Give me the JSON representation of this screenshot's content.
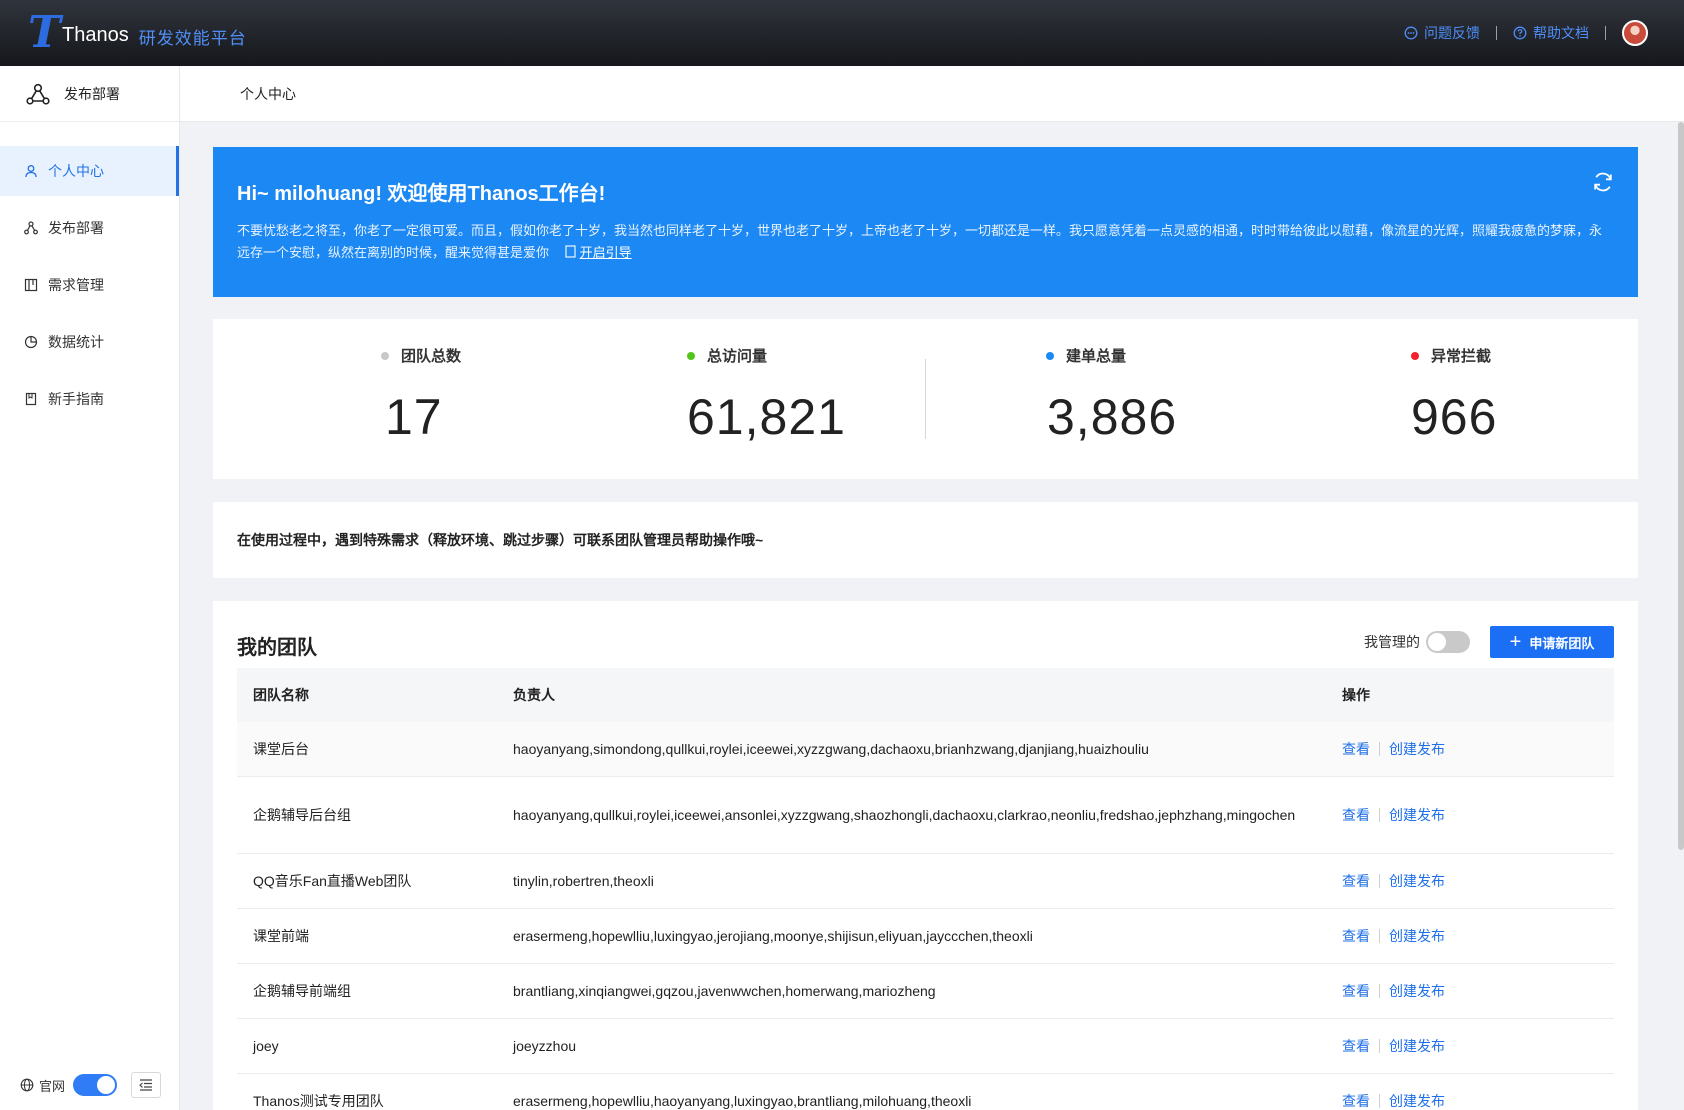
{
  "topbar": {
    "logo_letter": "T",
    "brand": "Thanos",
    "subtitle": "研发效能平台",
    "feedback": "问题反馈",
    "help": "帮助文档"
  },
  "sidebar": {
    "header": "发布部署",
    "items": [
      {
        "label": "个人中心",
        "icon": "user-icon",
        "active": true
      },
      {
        "label": "发布部署",
        "icon": "deploy-icon",
        "active": false
      },
      {
        "label": "需求管理",
        "icon": "board-icon",
        "active": false
      },
      {
        "label": "数据统计",
        "icon": "pie-chart-icon",
        "active": false
      },
      {
        "label": "新手指南",
        "icon": "book-icon",
        "active": false
      }
    ],
    "footer_label": "官网"
  },
  "breadcrumb": "个人中心",
  "banner": {
    "title": "Hi~ milohuang! 欢迎使用Thanos工作台!",
    "text": "不要忧愁老之将至，你老了一定很可爱。而且，假如你老了十岁，我当然也同样老了十岁，世界也老了十岁，上帝也老了十岁，一切都还是一样。我只愿意凭着一点灵感的相通，时时带给彼此以慰藉，像流星的光辉，照耀我疲惫的梦寐，永远存一个安慰，纵然在离别的时候，醒来觉得甚是爱你",
    "guide_link": "开启引导"
  },
  "stats": [
    {
      "label": "团队总数",
      "value": "17",
      "color": "#c8c8c8"
    },
    {
      "label": "总访问量",
      "value": "61,821",
      "color": "#52c41a"
    },
    {
      "label": "建单总量",
      "value": "3,886",
      "color": "#1b88f4"
    },
    {
      "label": "异常拦截",
      "value": "966",
      "color": "#f5222d"
    }
  ],
  "notice": "在使用过程中，遇到特殊需求（释放环境、跳过步骤）可联系团队管理员帮助操作哦~",
  "team": {
    "title": "我的团队",
    "mine_label": "我管理的",
    "apply_button": "申请新团队",
    "columns": [
      "团队名称",
      "负责人",
      "操作"
    ],
    "view_label": "查看",
    "create_label": "创建发布",
    "rows": [
      {
        "name": "课堂后台",
        "owners": "haoyanyang,simondong,qullkui,roylei,iceewei,xyzzgwang,dachaoxu,brianhzwang,djanjiang,huaizhouliu"
      },
      {
        "name": "企鹅辅导后台组",
        "owners": "haoyanyang,qullkui,roylei,iceewei,ansonlei,xyzzgwang,shaozhongli,dachaoxu,clarkrao,neonliu,fredshao,jephzhang,mingochen"
      },
      {
        "name": "QQ音乐Fan直播Web团队",
        "owners": "tinylin,robertren,theoxli"
      },
      {
        "name": "课堂前端",
        "owners": "erasermeng,hopewlliu,luxingyao,jerojiang,moonye,shijisun,eliyuan,jayccchen,theoxli"
      },
      {
        "name": "企鹅辅导前端组",
        "owners": "brantliang,xinqiangwei,gqzou,javenwwchen,homerwang,mariozheng"
      },
      {
        "name": "joey",
        "owners": "joeyzzhou"
      },
      {
        "name": "Thanos测试专用团队",
        "owners": "erasermeng,hopewlliu,haoyanyang,luxingyao,brantliang,milohuang,theoxli"
      }
    ]
  }
}
